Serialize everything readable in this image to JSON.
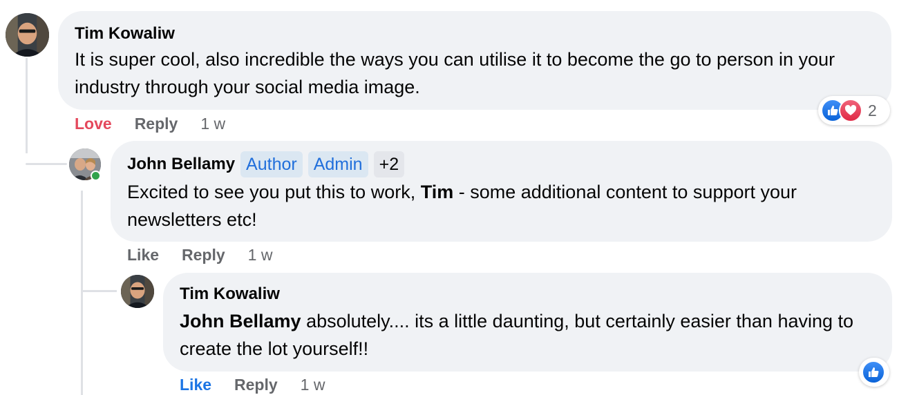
{
  "comments": [
    {
      "author": "Tim Kowaliw",
      "text": "It is super cool, also incredible the ways you can utilise it to become the go to person in your industry through your social media image.",
      "actions": {
        "reaction": "Love",
        "reply": "Reply",
        "time": "1 w"
      },
      "reactions": {
        "icons": [
          "like-icon",
          "love-icon"
        ],
        "count": "2"
      }
    },
    {
      "author": "John Bellamy",
      "badges": [
        "Author",
        "Admin",
        "+2"
      ],
      "text_before": "Excited to see you put this to work, ",
      "mention": "Tim",
      "text_after": " - some additional content to support your newsletters etc!",
      "online": true,
      "actions": {
        "reaction": "Like",
        "reply": "Reply",
        "time": "1 w"
      }
    },
    {
      "author": "Tim Kowaliw",
      "mention": "John Bellamy",
      "text_after": " absolutely.... its a little daunting, but certainly easier than having to create the lot yourself!!",
      "actions": {
        "reaction": "Like",
        "reply": "Reply",
        "time": "1 w"
      },
      "reactions": {
        "icons": [
          "like-icon"
        ]
      }
    }
  ],
  "colors": {
    "bubble": "#f0f2f5",
    "love": "#e4485c",
    "like_active": "#1b74e4",
    "badge_bg": "#dbe7f2",
    "badge_text": "#216fdb",
    "muted": "#65676b"
  }
}
